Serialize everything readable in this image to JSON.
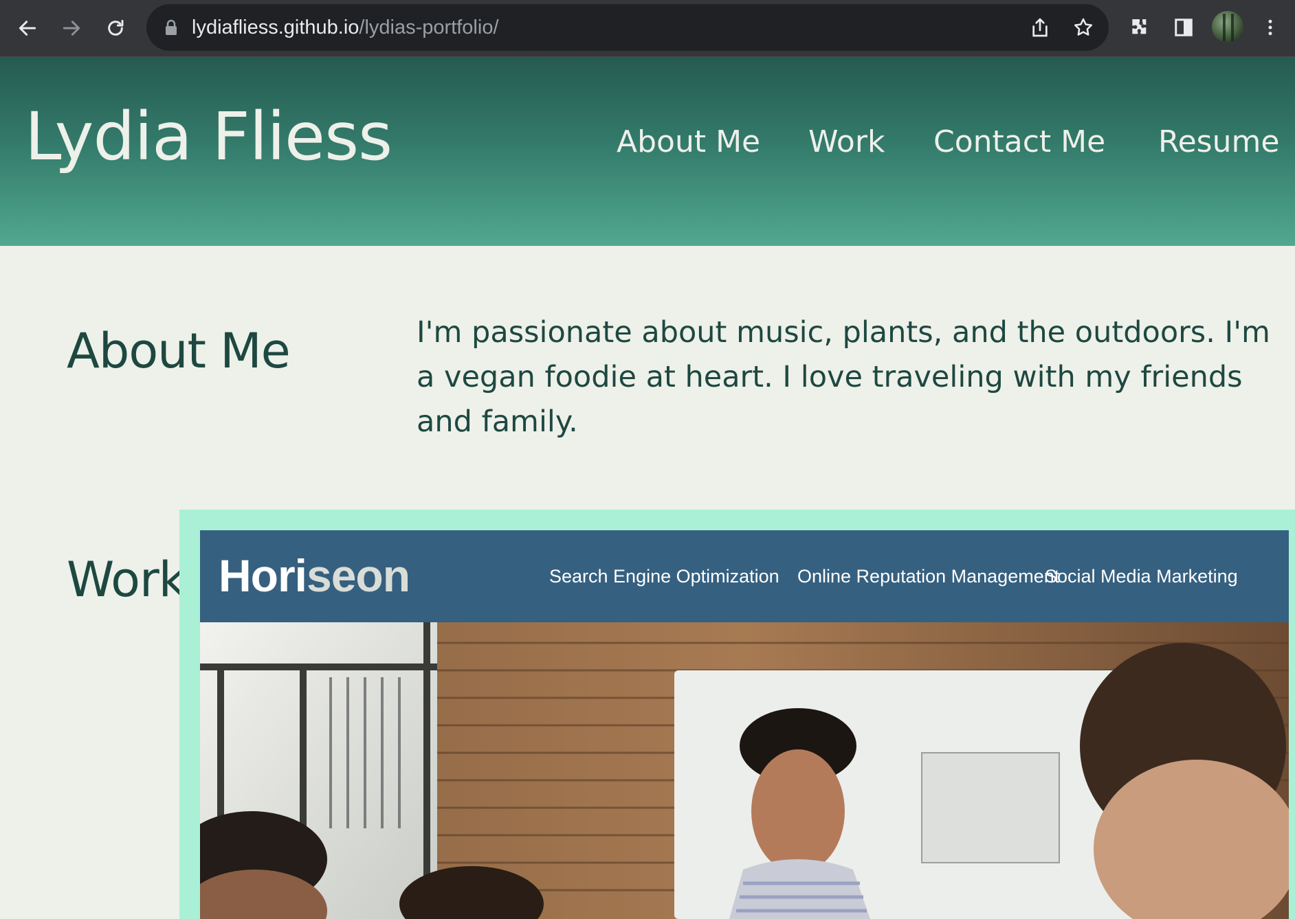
{
  "browser": {
    "url_host": "lydiafliess.github.io",
    "url_path": "/lydias-portfolio/"
  },
  "site": {
    "title": "Lydia Fliess",
    "nav": [
      "About Me",
      "Work",
      "Contact Me",
      "Resume"
    ]
  },
  "about": {
    "heading": "About Me",
    "text": "I'm passionate about music, plants, and the outdoors. I'm a vegan foodie at heart. I love traveling with my friends and family."
  },
  "work": {
    "heading": "Work",
    "project": {
      "logo_main": "Hori",
      "logo_accent": "seon",
      "nav": [
        "Search Engine Optimization",
        "Online Reputation Management",
        "Social Media Marketing"
      ]
    }
  },
  "colors": {
    "header_gradient_top": "#265a52",
    "header_gradient_bottom": "#51a88f",
    "page_background": "#eef0ea",
    "heading_text": "#1d4840",
    "work_frame_accent": "#a9f0d6",
    "project_header": "#36607f"
  }
}
